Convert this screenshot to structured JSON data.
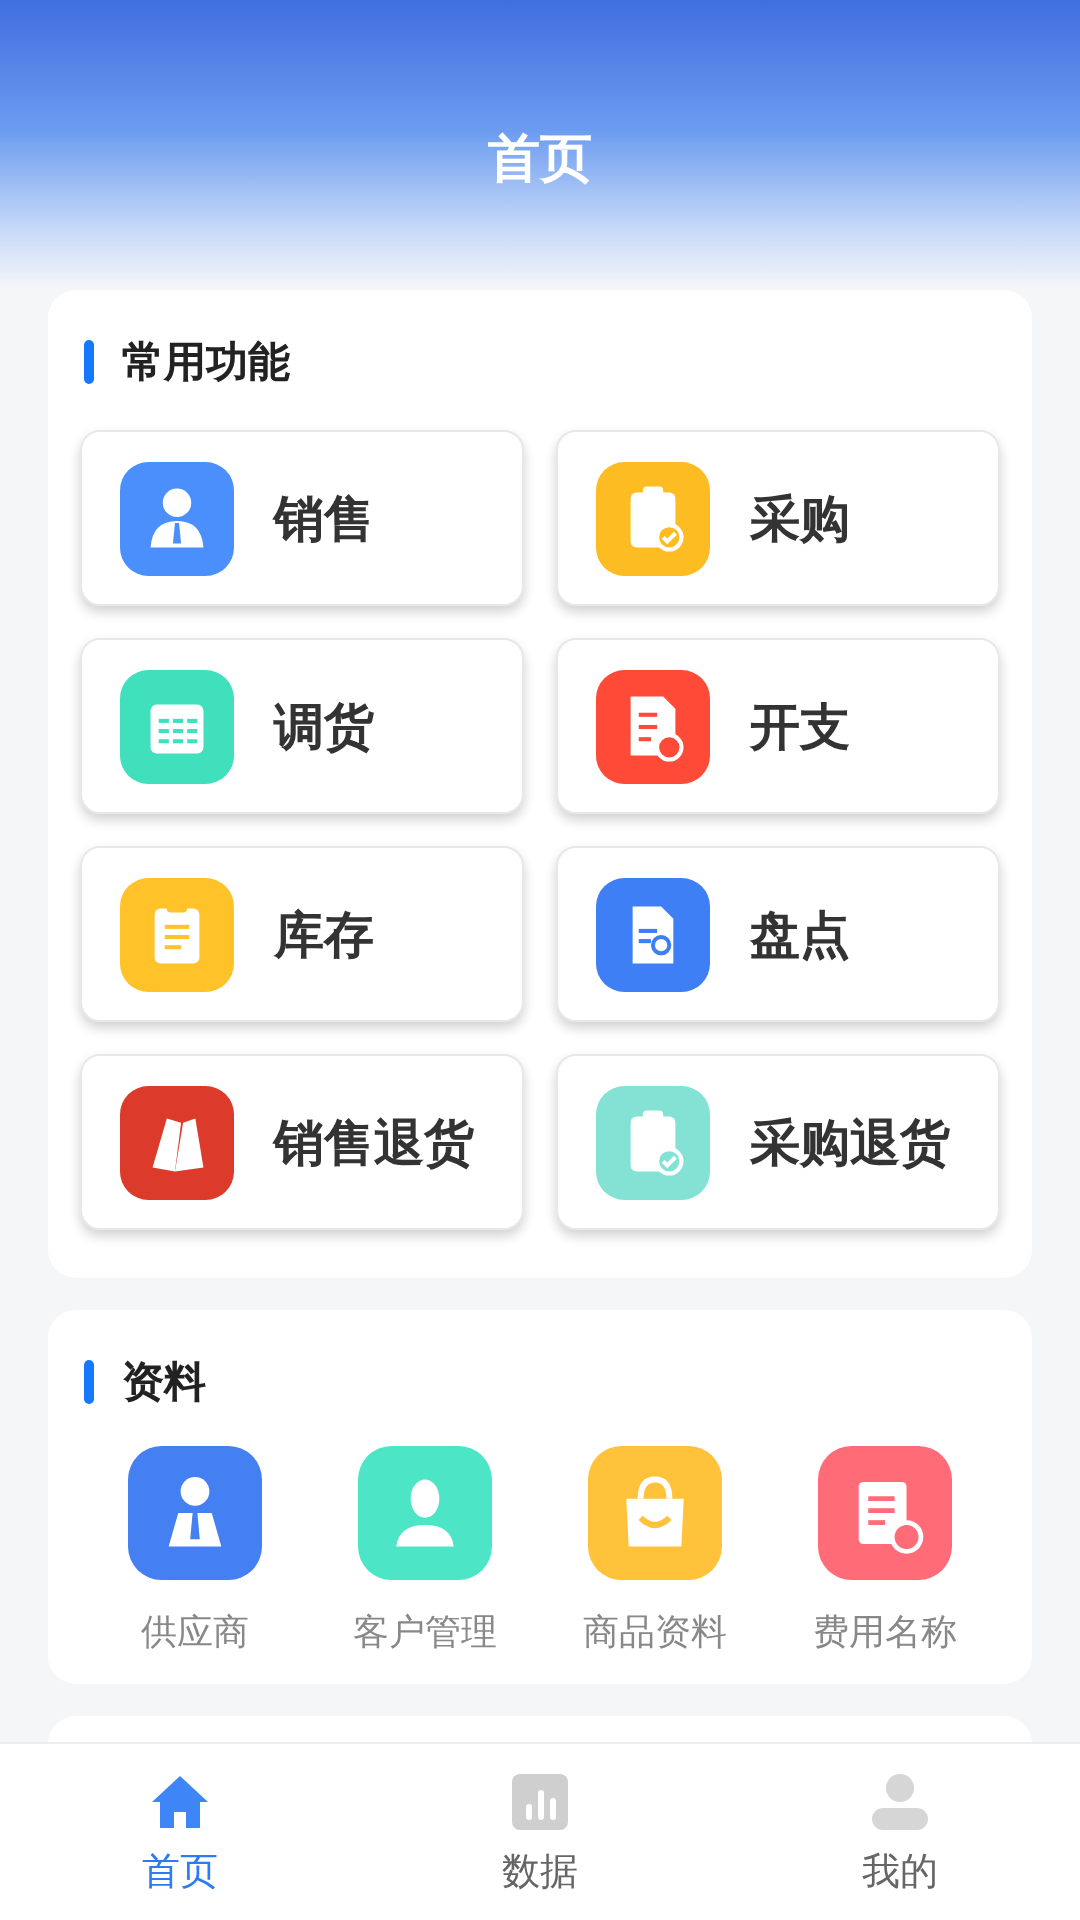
{
  "header": {
    "title": "首页"
  },
  "common": {
    "title": "常用功能",
    "items": [
      {
        "label": "销售",
        "kind": "person",
        "color": "#4b8ffc"
      },
      {
        "label": "采购",
        "kind": "clipcheck",
        "color": "#fdbd22"
      },
      {
        "label": "调货",
        "kind": "calendar",
        "color": "#41e0bd"
      },
      {
        "label": "开支",
        "kind": "receipt",
        "color": "#fe4a36"
      },
      {
        "label": "库存",
        "kind": "clipboard",
        "color": "#ffc228"
      },
      {
        "label": "盘点",
        "kind": "docsearch",
        "color": "#3f7ff5"
      },
      {
        "label": "销售退货",
        "kind": "tag",
        "color": "#dc3a2a"
      },
      {
        "label": "采购退货",
        "kind": "clipcheck",
        "color": "#84e2d4"
      }
    ]
  },
  "resources": {
    "title": "资料",
    "items": [
      {
        "label": "供应商",
        "kind": "person",
        "color": "#4580f2"
      },
      {
        "label": "客户管理",
        "kind": "user",
        "color": "#4ce6c6"
      },
      {
        "label": "商品资料",
        "kind": "bag",
        "color": "#ffc23a"
      },
      {
        "label": "费用名称",
        "kind": "receipt",
        "color": "#ff6c78"
      }
    ]
  },
  "tabs": [
    {
      "label": "首页",
      "kind": "home",
      "selected": true
    },
    {
      "label": "数据",
      "kind": "chart",
      "selected": false
    },
    {
      "label": "我的",
      "kind": "user",
      "selected": false
    }
  ]
}
